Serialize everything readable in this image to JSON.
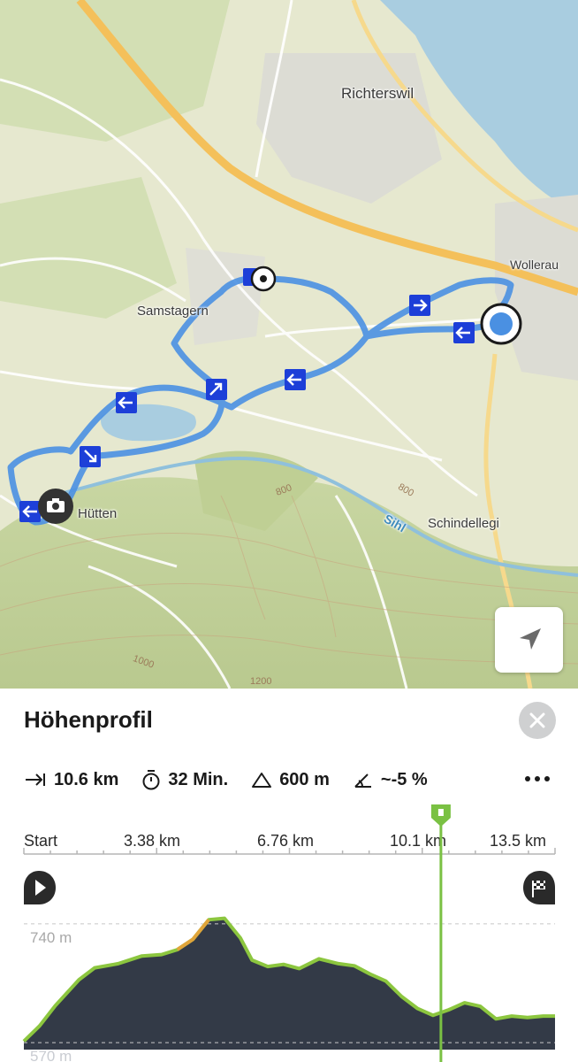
{
  "map": {
    "places": [
      "Richterswil",
      "Wollerau",
      "Samstagern",
      "Hütten",
      "Schindellegi"
    ],
    "river": "Sihl",
    "contours": [
      "800",
      "800",
      "1000",
      "1200"
    ],
    "route_color": "#4a90e2",
    "colors": {
      "water": "#a9cde0",
      "land": "#e3e6c8",
      "forest": "#c9d7a7",
      "main_road": "#f4c05a"
    }
  },
  "panel": {
    "title": "Höhenprofil",
    "stats": {
      "distance": "10.6 km",
      "duration": "32 Min.",
      "elevation": "600 m",
      "grade": "~-5 %"
    },
    "distance_ticks": [
      "Start",
      "3.38 km",
      "6.76 km",
      "10.1 km",
      "13.5 km"
    ]
  },
  "chart_data": {
    "type": "area",
    "xlabel": "",
    "ylabel": "",
    "x_ticks": [
      "Start",
      "3.38 km",
      "6.76 km",
      "10.1 km",
      "13.5 km"
    ],
    "y_ticks": [
      "740 m",
      "570 m"
    ],
    "x_km": [
      0,
      0.4,
      0.8,
      1.4,
      1.8,
      2.4,
      3.0,
      3.5,
      3.9,
      4.3,
      4.7,
      5.1,
      5.5,
      5.8,
      6.2,
      6.6,
      7.0,
      7.5,
      8.0,
      8.4,
      8.8,
      9.2,
      9.6,
      10.0,
      10.4,
      10.8,
      11.2,
      11.6,
      12.0,
      12.4,
      12.8,
      13.2,
      13.5
    ],
    "elevation_m": [
      572,
      594,
      623,
      660,
      677,
      683,
      694,
      696,
      703,
      718,
      746,
      748,
      720,
      688,
      679,
      682,
      676,
      690,
      683,
      680,
      668,
      658,
      636,
      619,
      609,
      617,
      627,
      622,
      604,
      608,
      606,
      608,
      608
    ],
    "ylim": [
      560,
      750
    ],
    "current_position_km": 10.6,
    "colors": {
      "fill": "#333a47",
      "line": "#8cc63f",
      "steep": "#e0a43a",
      "marker": "#7ac143"
    }
  }
}
